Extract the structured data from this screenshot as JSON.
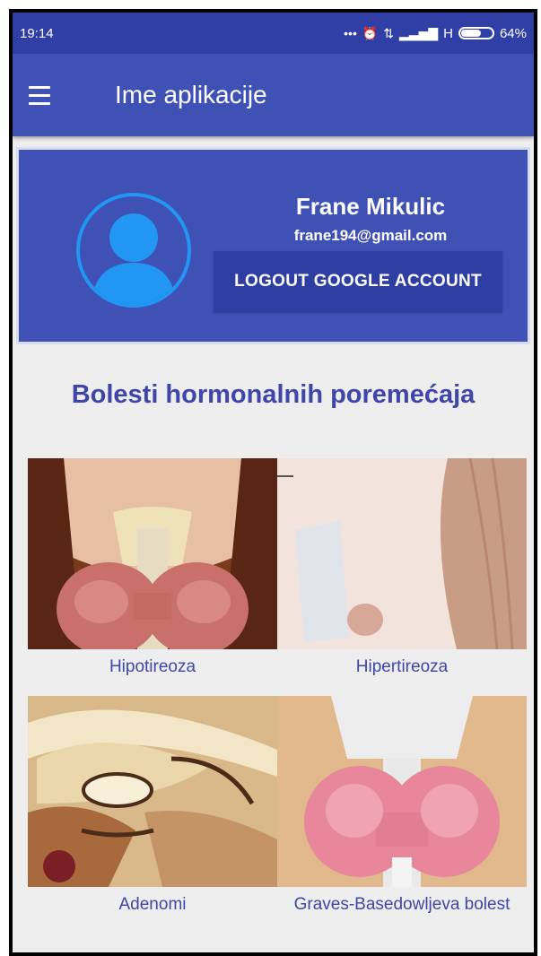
{
  "status_bar": {
    "time": "19:14",
    "icons": [
      "more-icon",
      "alarm-icon",
      "data-arrows-icon",
      "signal-icon"
    ],
    "network": "H",
    "battery_percent": "64%",
    "battery_level": 0.64
  },
  "app_bar": {
    "title": "Ime aplikacije",
    "menu_icon": "hamburger-menu-icon"
  },
  "profile": {
    "name": "Frane Mikulic",
    "email": "frane194@gmail.com",
    "logout_label": "LOGOUT GOOGLE ACCOUNT",
    "avatar_icon": "person-avatar-icon"
  },
  "section_title": "Bolesti hormonalnih poremećaja",
  "tiles": [
    {
      "label": "Hipotireoza",
      "image": "thyroid-illustration"
    },
    {
      "label": "Hipertireoza",
      "image": "neck-illustration"
    },
    {
      "label": "Adenomi",
      "image": "brain-section-illustration"
    },
    {
      "label": "Graves-Basedowljeva bolest",
      "image": "thyroid-gland-illustration"
    }
  ],
  "colors": {
    "primary": "#3f51b5",
    "primary_dark": "#2f3fa6",
    "accent_text": "#3f46a8",
    "avatar_ring": "#2196f3",
    "background": "#eeeeee"
  }
}
